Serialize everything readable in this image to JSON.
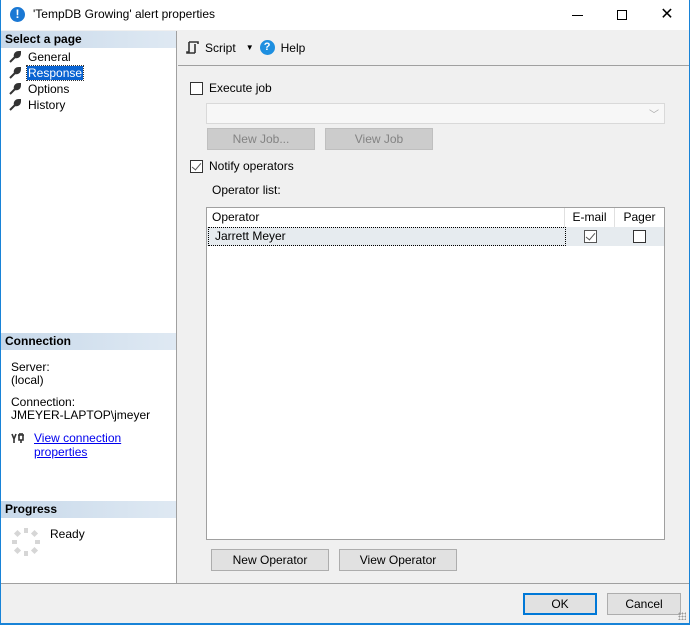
{
  "window": {
    "title": "'TempDB Growing' alert properties",
    "icon": "alert-info-icon",
    "controls": {
      "minimize": "minimize",
      "maximize": "maximize",
      "close": "✕"
    }
  },
  "sidebar": {
    "select_page_header": "Select a page",
    "pages": [
      {
        "label": "General",
        "icon": "wrench-icon",
        "selected": false
      },
      {
        "label": "Response",
        "icon": "wrench-icon",
        "selected": true
      },
      {
        "label": "Options",
        "icon": "wrench-icon",
        "selected": false
      },
      {
        "label": "History",
        "icon": "wrench-icon",
        "selected": false
      }
    ],
    "connection": {
      "header": "Connection",
      "server_label": "Server:",
      "server_value": "(local)",
      "connection_label": "Connection:",
      "connection_value": "JMEYER-LAPTOP\\jmeyer",
      "view_link": "View connection properties"
    },
    "progress": {
      "header": "Progress",
      "status": "Ready"
    }
  },
  "toolbar": {
    "script_label": "Script",
    "dropdown_glyph": "▼",
    "help_label": "Help",
    "help_glyph": "?"
  },
  "response": {
    "execute_job": {
      "label": "Execute job",
      "checked": false
    },
    "job_combo_value": "",
    "combo_arrow": "﹀",
    "new_job_button": "New Job...",
    "view_job_button": "View Job",
    "notify_operators": {
      "label": "Notify operators",
      "checked": true
    },
    "operator_list_label": "Operator list:",
    "grid": {
      "columns": [
        "Operator",
        "E-mail",
        "Pager"
      ],
      "rows": [
        {
          "operator": "Jarrett Meyer",
          "email": true,
          "pager": false
        }
      ]
    },
    "new_operator_button": "New Operator",
    "view_operator_button": "View Operator"
  },
  "footer": {
    "ok_button": "OK",
    "cancel_button": "Cancel"
  },
  "colors": {
    "accent": "#0078d7",
    "selection": "#0a64d2",
    "link": "#0000ee",
    "section_header": "#c8d9ea"
  }
}
